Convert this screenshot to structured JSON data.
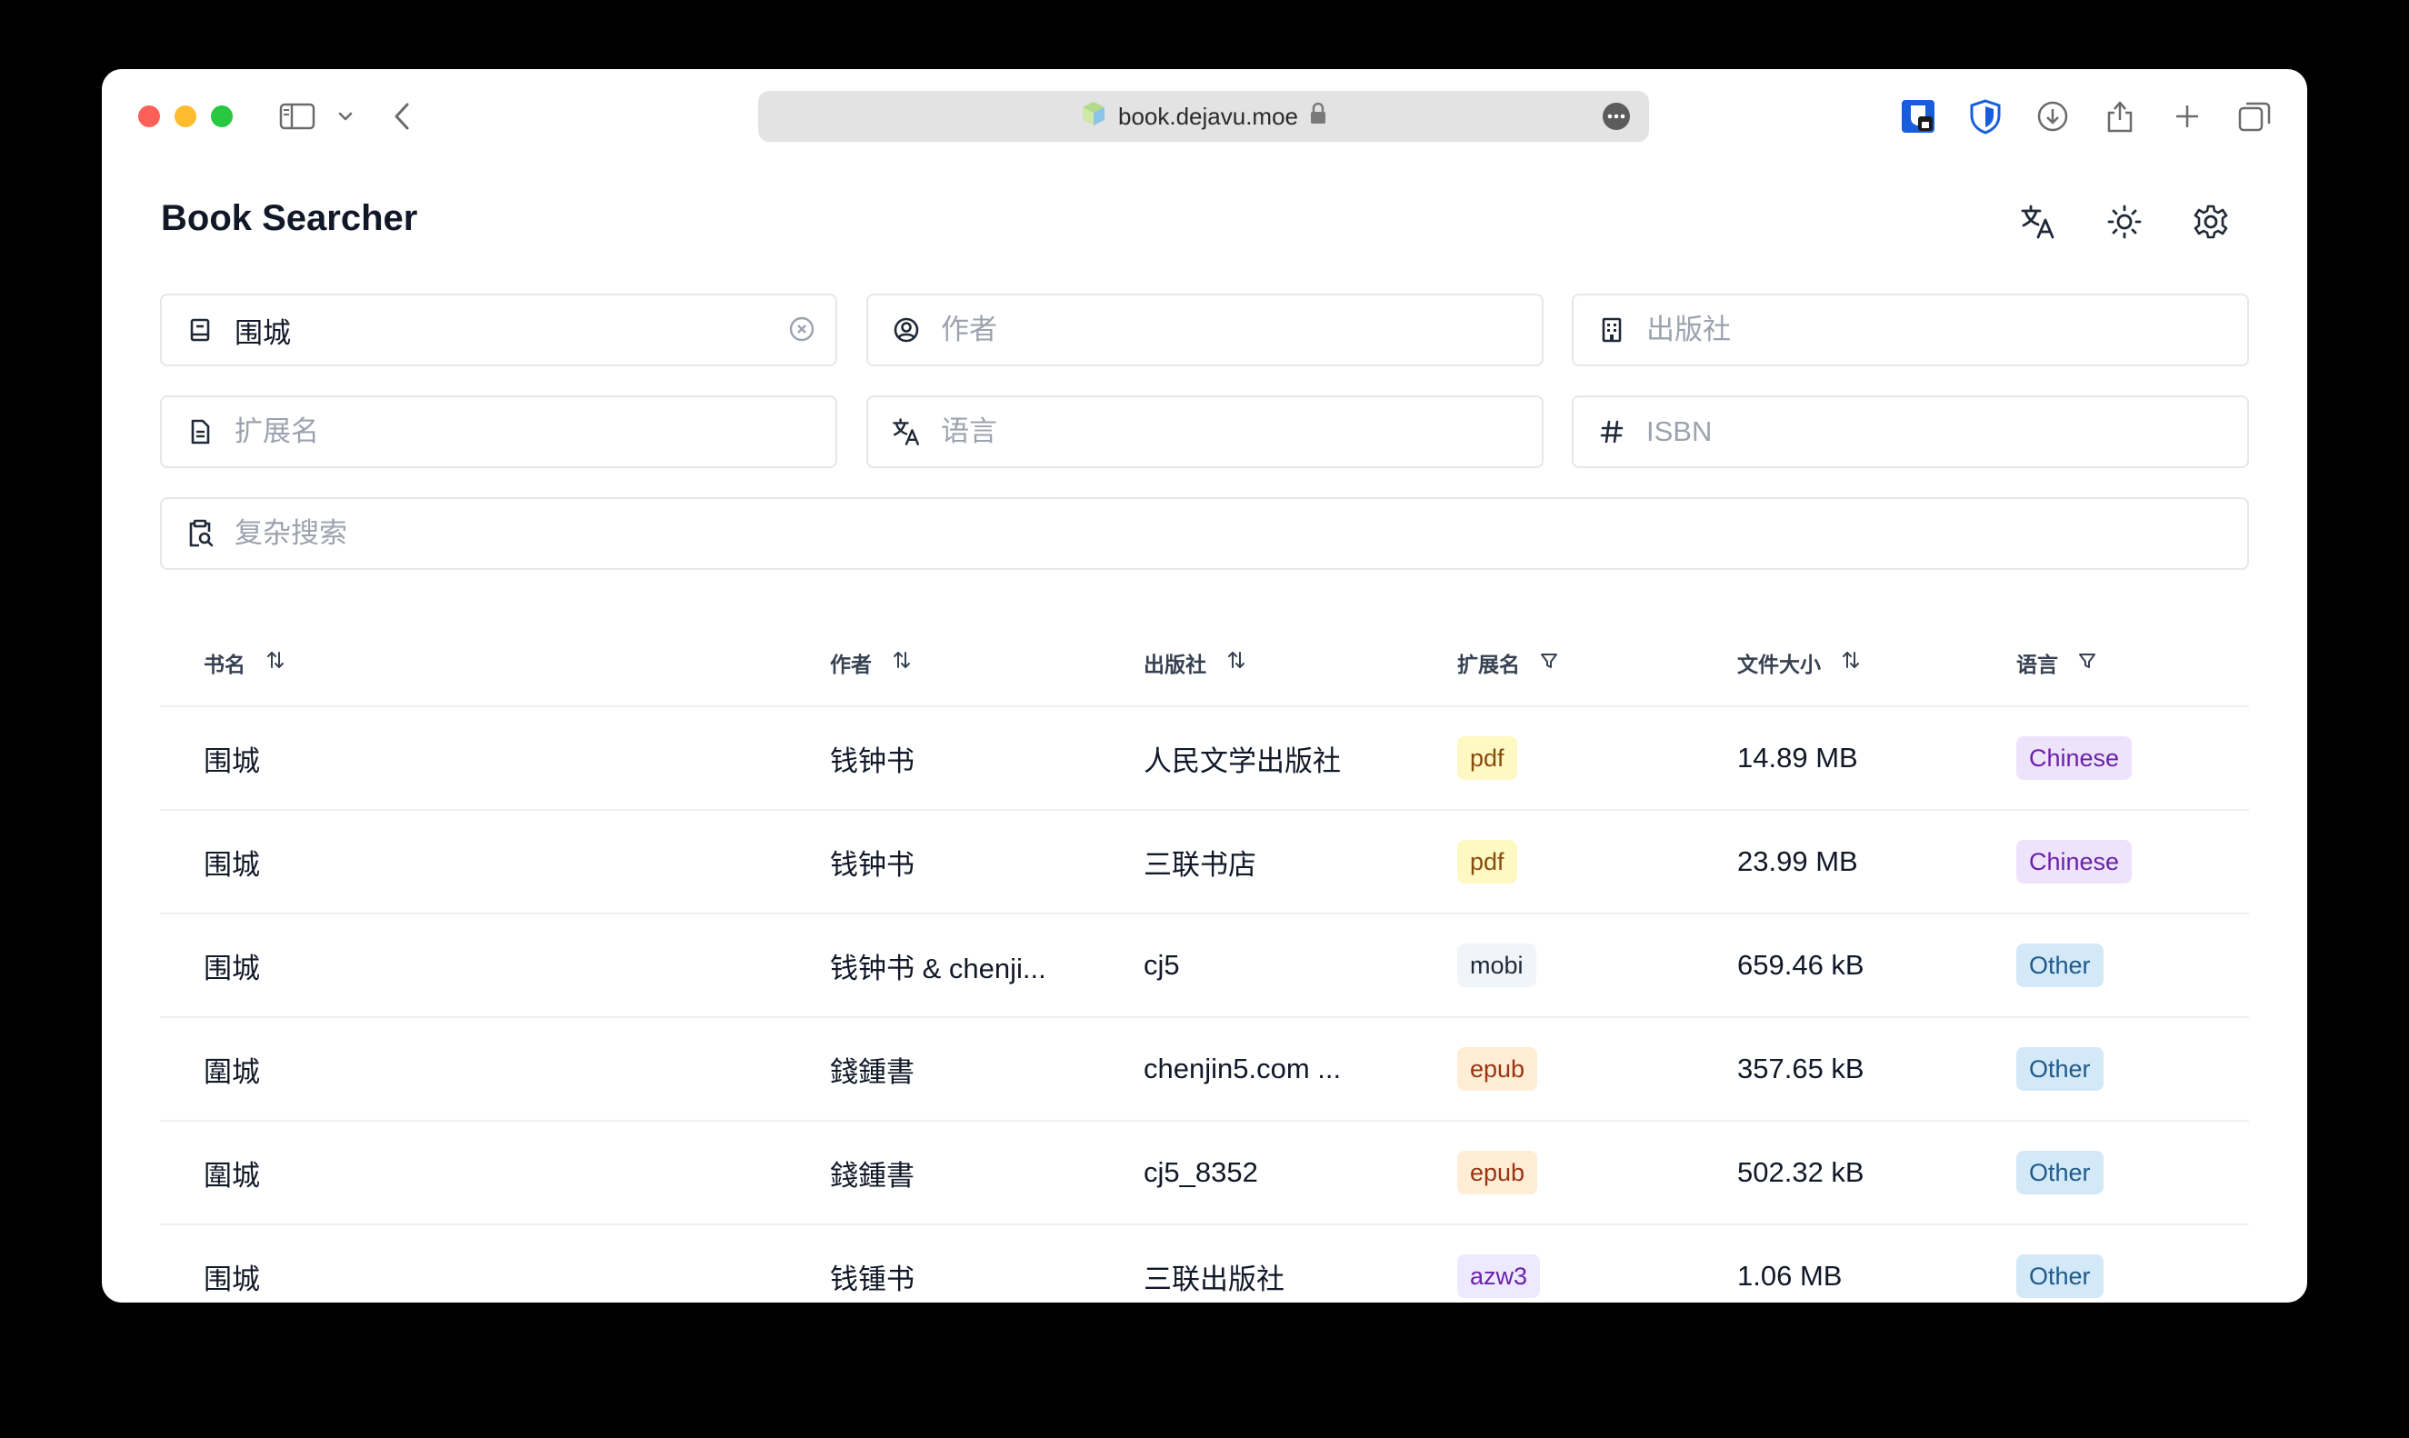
{
  "browser": {
    "url": "book.dejavu.moe"
  },
  "app": {
    "title": "Book Searcher"
  },
  "search": {
    "title_value": "围城",
    "author_placeholder": "作者",
    "publisher_placeholder": "出版社",
    "extension_placeholder": "扩展名",
    "language_placeholder": "语言",
    "isbn_placeholder": "ISBN",
    "complex_placeholder": "复杂搜索"
  },
  "table": {
    "headers": {
      "title": "书名",
      "author": "作者",
      "publisher": "出版社",
      "extension": "扩展名",
      "filesize": "文件大小",
      "language": "语言"
    },
    "rows": [
      {
        "title": "围城",
        "author": "钱钟书",
        "publisher": "人民文学出版社",
        "extension": "pdf",
        "filesize": "14.89 MB",
        "language": "Chinese"
      },
      {
        "title": "围城",
        "author": "钱钟书",
        "publisher": "三联书店",
        "extension": "pdf",
        "filesize": "23.99 MB",
        "language": "Chinese"
      },
      {
        "title": "围城",
        "author": "钱钟书 & chenji...",
        "publisher": "cj5",
        "extension": "mobi",
        "filesize": "659.46 kB",
        "language": "Other"
      },
      {
        "title": "圍城",
        "author": "錢鍾書",
        "publisher": "chenjin5.com ...",
        "extension": "epub",
        "filesize": "357.65 kB",
        "language": "Other"
      },
      {
        "title": "圍城",
        "author": "錢鍾書",
        "publisher": "cj5_8352",
        "extension": "epub",
        "filesize": "502.32 kB",
        "language": "Other"
      },
      {
        "title": "围城",
        "author": "钱锺书",
        "publisher": "三联出版社",
        "extension": "azw3",
        "filesize": "1.06 MB",
        "language": "Other"
      }
    ]
  },
  "colors": {
    "ext_pdf_bg": "#fef9c3",
    "ext_pdf_fg": "#854d0e",
    "ext_mobi_bg": "#f1f5f9",
    "ext_mobi_fg": "#1e293b",
    "ext_epub_bg": "#ffedd5",
    "ext_epub_fg": "#9a3412",
    "ext_azw3_bg": "#ede9fe",
    "ext_azw3_fg": "#6b21a8",
    "lang_chinese_bg": "#ede4fb",
    "lang_chinese_fg": "#6b21a8",
    "lang_other_bg": "#d4e9f8",
    "lang_other_fg": "#1e5a8a"
  }
}
